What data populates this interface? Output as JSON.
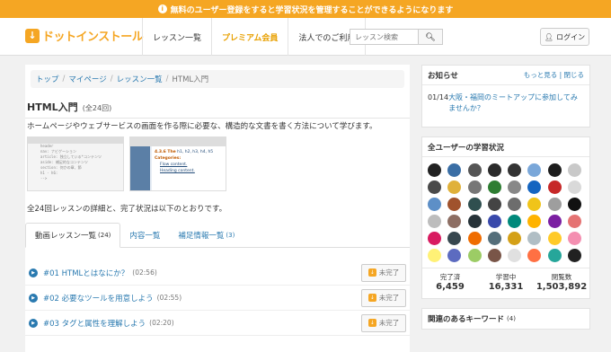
{
  "banner": {
    "text": "無料のユーザー登録をすると学習状況を管理することができるようになります",
    "icon": "info-icon"
  },
  "header": {
    "logo_text": "ドットインストール",
    "nav": [
      {
        "label": "レッスン一覧"
      },
      {
        "label": "プレミアム会員"
      },
      {
        "label": "法人でのご利用"
      }
    ],
    "search_placeholder": "レッスン検索",
    "login_label": "ログイン"
  },
  "breadcrumb": [
    "トップ",
    "マイページ",
    "レッスン一覧",
    "HTML入門"
  ],
  "page": {
    "title": "HTML入門",
    "count": "(全24回)",
    "description": "ホームページやウェブサービスの画面を作る際に必要な、構造的な文書を書く方法について学びます。",
    "detail": "全24回レッスンの詳細と、完了状況は以下のとおりです。"
  },
  "thumb1_lines": [
    "header",
    "nav: ナビゲーション",
    "article: 独立している*コンテンツ",
    "aside: 補足的なコンテンツ",
    "section: 何かの章、節",
    "h1 - h6:",
    "-->"
  ],
  "thumb2": {
    "heading": "4.3.6 The",
    "heading_rest": "h1, h2, h3, h4, h5",
    "categories": "Categories:",
    "links": [
      "Flow content.",
      "Heading content."
    ]
  },
  "tabs": [
    {
      "label": "動画レッスン一覧",
      "count": "(24)"
    },
    {
      "label": "内容一覧",
      "count": ""
    },
    {
      "label": "補足情報一覧",
      "count": "(3)"
    }
  ],
  "lessons": [
    {
      "name": "#01 HTMLとはなにか？",
      "time": "(02:56)"
    },
    {
      "name": "#02 必要なツールを用意しよう",
      "time": "(02:55)"
    },
    {
      "name": "#03 タグと属性を理解しよう",
      "time": "(02:20)"
    }
  ],
  "incomplete_label": "未完了",
  "news": {
    "title": "お知らせ",
    "links": "もっと見る | 閉じる",
    "date": "01/14",
    "text": "大阪・福岡のミートアップに参加してみませんか？"
  },
  "learners": {
    "title": "全ユーザーの学習状況",
    "stats": [
      {
        "label": "完了済",
        "value": "6,459"
      },
      {
        "label": "学習中",
        "value": "16,331"
      },
      {
        "label": "閲覧数",
        "value": "1,503,892"
      }
    ]
  },
  "keywords": {
    "title": "関連のあるキーワード",
    "count": "(4)"
  },
  "colors": {
    "accent": "#f5a623",
    "link": "#2a7ab0"
  }
}
